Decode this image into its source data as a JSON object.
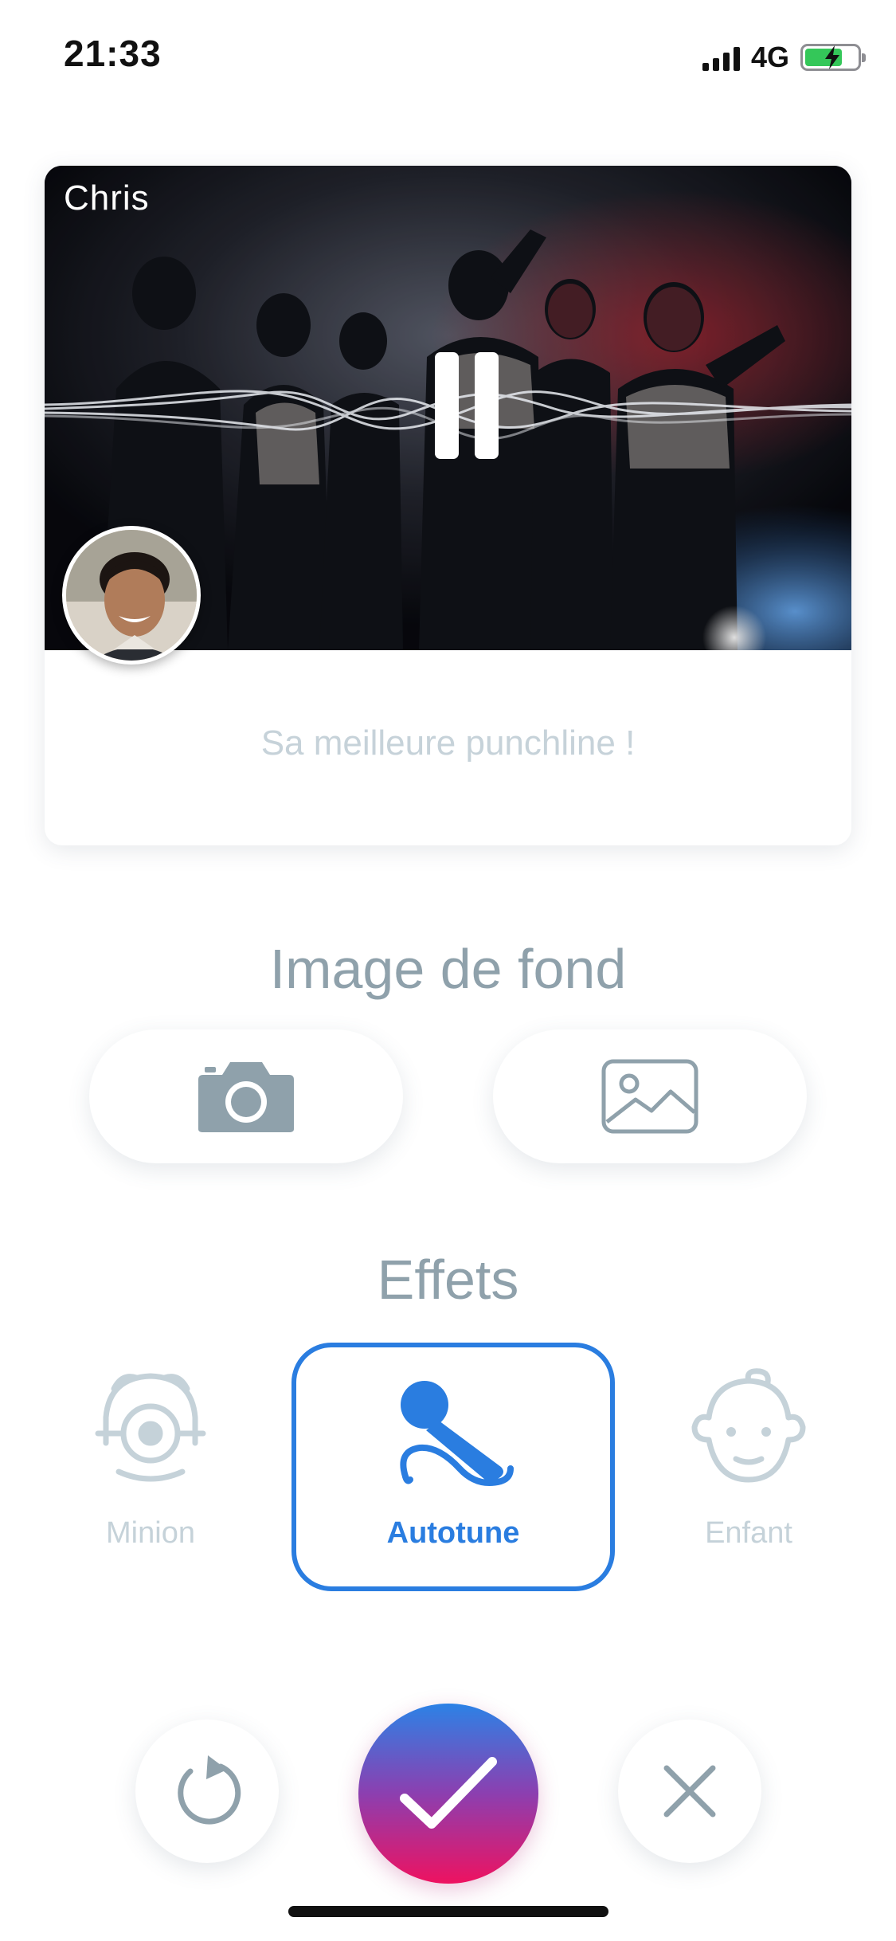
{
  "status_bar": {
    "time": "21:33",
    "network": "4G",
    "battery_level": 0.72,
    "battery_charging": true,
    "signal_bars": 4
  },
  "card": {
    "author": "Chris",
    "caption": "Sa meilleure punchline !",
    "playback_icon": "pause-icon"
  },
  "background_section": {
    "title": "Image de fond",
    "buttons": [
      {
        "icon": "camera-icon"
      },
      {
        "icon": "gallery-icon"
      }
    ]
  },
  "effects_section": {
    "title": "Effets",
    "items": [
      {
        "label": "Minion",
        "icon": "minion-icon",
        "selected": false
      },
      {
        "label": "Autotune",
        "icon": "microphone-icon",
        "selected": true
      },
      {
        "label": "Enfant",
        "icon": "baby-face-icon",
        "selected": false
      }
    ]
  },
  "actions": [
    {
      "icon": "retry-icon"
    },
    {
      "icon": "check-icon"
    },
    {
      "icon": "close-icon"
    }
  ],
  "colors": {
    "accent": "#2a7de0",
    "muted": "#8fa1ab",
    "inactive": "#c5d2d9",
    "gradient_top": "#2c82e6",
    "gradient_bottom": "#ee1260"
  }
}
